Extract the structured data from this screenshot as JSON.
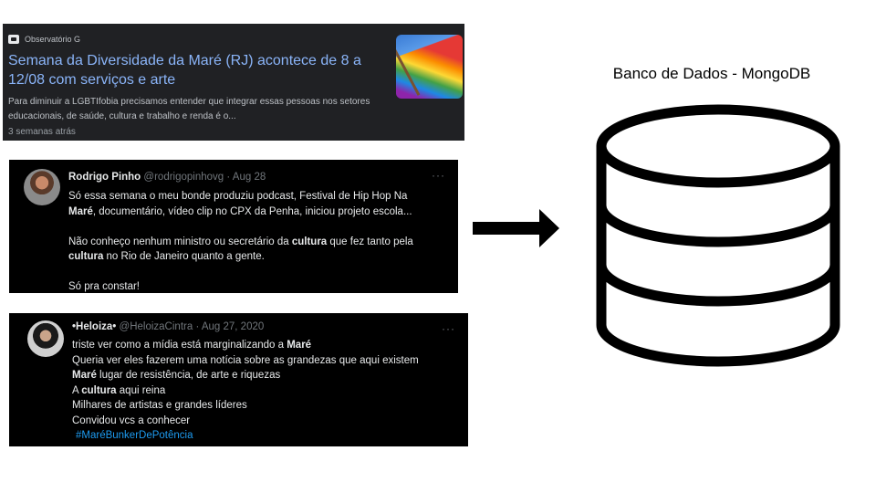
{
  "news": {
    "source": "Observatório G",
    "title": "Semana da Diversidade da Maré (RJ) acontece de 8 a 12/08 com serviços e arte",
    "snippet": "Para diminuir a LGBTIfobia precisamos entender que integrar essas pessoas nos setores educacionais, de saúde, cultura e trabalho e renda é o...",
    "time": "3 semanas atrás",
    "thumbnail": "rainbow-flag-image"
  },
  "tweet1": {
    "name": "Rodrigo Pinho",
    "handle": "@rodrigopinhovg",
    "date": "Aug 28",
    "more": "···",
    "lines": [
      [
        "Só essa semana o meu bonde produziu podcast, Festival de Hip Hop Na"
      ],
      [
        "Maré",
        ", documentário, vídeo clip no CPX da Penha, iniciou projeto escola..."
      ],
      [
        "Não conheço nenhum ministro ou secretário da ",
        "cultura",
        " que fez tanto pela"
      ],
      [
        "cultura",
        " no Rio de Janeiro quanto a gente."
      ],
      [
        "Só pra constar!"
      ]
    ]
  },
  "tweet2": {
    "name": "•Heloiza•",
    "handle": "@HeloizaCintra",
    "date": "Aug 27, 2020",
    "more": "···",
    "lines": [
      [
        "triste ver como a mídia está marginalizando a ",
        "Maré"
      ],
      [
        "Queria ver eles fazerem uma notícia sobre as grandezas que aqui existem"
      ],
      [
        "Maré",
        " lugar de resistência, de arte e riquezas"
      ],
      [
        "A ",
        "cultura",
        " aqui reina"
      ],
      [
        "Milhares de artistas e grandes líderes"
      ],
      [
        "Convidou vcs a conhecer"
      ]
    ],
    "hashtag": "#MaréBunkerDePotência"
  },
  "database": {
    "label": "Banco de Dados - MongoDB",
    "icon": "database-icon"
  },
  "colors": {
    "news_bg": "#202124",
    "news_title": "#8ab4f8",
    "tweet_bg": "#000000",
    "hashtag": "#1d9bf0",
    "arrow": "#000000"
  }
}
